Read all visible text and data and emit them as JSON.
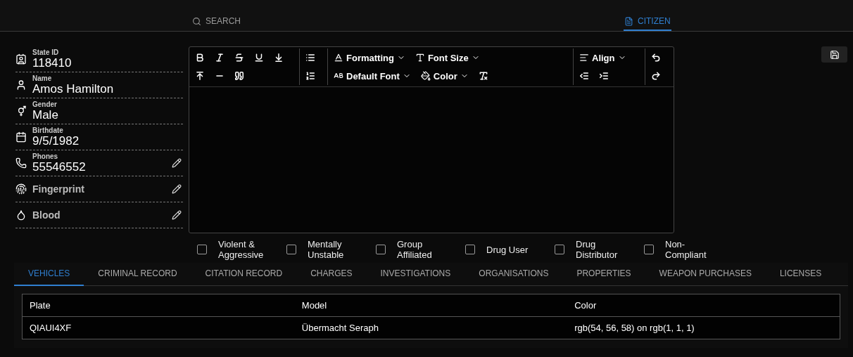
{
  "nav": [
    {
      "label": "SEARCH",
      "kind": "search",
      "selected": false
    },
    {
      "label": "CITIZEN",
      "kind": "document",
      "selected": true
    }
  ],
  "profile": [
    {
      "kind": "id",
      "label": "State ID",
      "value": "118410",
      "editable": false
    },
    {
      "kind": "person",
      "label": "Name",
      "value": "Amos Hamilton",
      "editable": false
    },
    {
      "kind": "gender",
      "label": "Gender",
      "value": "Male",
      "editable": false
    },
    {
      "kind": "calendar",
      "label": "Birthdate",
      "value": "9/5/1982",
      "editable": false
    },
    {
      "kind": "phone",
      "label": "Phones",
      "value": "55546552",
      "editable": true
    },
    {
      "kind": "fingerprint",
      "value": "Fingerprint",
      "editable": true
    },
    {
      "kind": "droplet",
      "value": "Blood",
      "editable": true
    }
  ],
  "editor": {
    "dropdowns": [
      "Formatting",
      "Font Size",
      "Align",
      "Default Font",
      "Color"
    ]
  },
  "flags": [
    {
      "label": "Violent & Aggressive",
      "checked": false
    },
    {
      "label": "Mentally Unstable",
      "checked": false
    },
    {
      "label": "Group Affiliated",
      "checked": false
    },
    {
      "label": "Drug User",
      "checked": false
    },
    {
      "label": "Drug Distributor",
      "checked": false
    },
    {
      "label": "Non-Compliant",
      "checked": false
    }
  ],
  "tabs": [
    {
      "label": "VEHICLES",
      "selected": true
    },
    {
      "label": "CRIMINAL RECORD",
      "selected": false
    },
    {
      "label": "CITATION RECORD",
      "selected": false
    },
    {
      "label": "CHARGES",
      "selected": false
    },
    {
      "label": "INVESTIGATIONS",
      "selected": false
    },
    {
      "label": "ORGANISATIONS",
      "selected": false
    },
    {
      "label": "PROPERTIES",
      "selected": false
    },
    {
      "label": "WEAPON PURCHASES",
      "selected": false
    },
    {
      "label": "LICENSES",
      "selected": false
    }
  ],
  "table": {
    "columns": [
      "Plate",
      "Model",
      "Color"
    ],
    "rows": [
      [
        "QIAUI4XF",
        "Übermacht Seraph",
        "rgb(54, 56, 58) on rgb(1, 1, 1)"
      ]
    ]
  }
}
